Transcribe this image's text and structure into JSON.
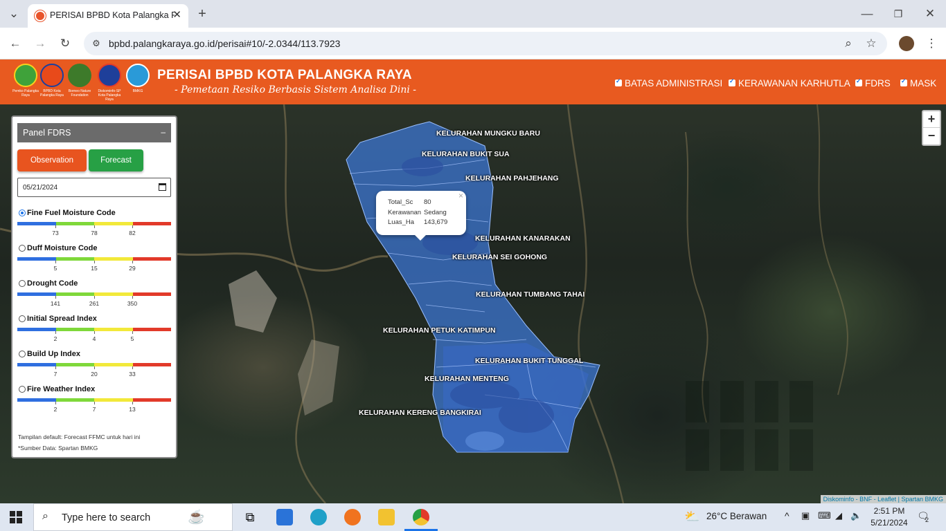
{
  "browser": {
    "tab_title": "PERISAI BPBD Kota Palangka Ra",
    "url": "bpbd.palangkaraya.go.id/perisai#10/-2.0344/113.7923"
  },
  "header": {
    "logos": [
      {
        "caption": "Pemko Palangka Raya"
      },
      {
        "caption": "BPBD Kota Palangka Raya"
      },
      {
        "caption": "Borneo Nature Foundation"
      },
      {
        "caption": "Diskominfo-SP Kota Palangka Raya"
      },
      {
        "caption": "BMKG"
      }
    ],
    "title": "PERISAI BPBD KOTA PALANGKA RAYA",
    "subtitle": "- Pemetaan Resiko Berbasis Sistem Analisa Dini -",
    "layers": [
      {
        "label": "BATAS ADMINISTRASI",
        "checked": true
      },
      {
        "label": "KERAWANAN KARHUTLA",
        "checked": true
      },
      {
        "label": "FDRS",
        "checked": true
      },
      {
        "label": "MASK",
        "checked": true
      }
    ]
  },
  "panel": {
    "title": "Panel FDRS",
    "minimize": "–",
    "observation_label": "Observation",
    "forecast_label": "Forecast",
    "date": "05/21/2024",
    "indices": [
      {
        "label": "Fine Fuel Moisture Code",
        "selected": true,
        "ticks": [
          "73",
          "78",
          "82"
        ]
      },
      {
        "label": "Duff Moisture Code",
        "selected": false,
        "ticks": [
          "5",
          "15",
          "29"
        ]
      },
      {
        "label": "Drought Code",
        "selected": false,
        "ticks": [
          "141",
          "261",
          "350"
        ]
      },
      {
        "label": "Initial Spread Index",
        "selected": false,
        "ticks": [
          "2",
          "4",
          "5"
        ]
      },
      {
        "label": "Build Up Index",
        "selected": false,
        "ticks": [
          "7",
          "20",
          "33"
        ]
      },
      {
        "label": "Fire Weather Index",
        "selected": false,
        "ticks": [
          "2",
          "7",
          "13"
        ]
      }
    ],
    "scale_colors": [
      "#2f6fe0",
      "#7fd83a",
      "#f2e93a",
      "#e23a2a"
    ],
    "note_default": "Tampilan default: Forecast FFMC untuk hari ini",
    "note_source": "*Sumber Data: Spartan BMKG"
  },
  "map": {
    "labels": [
      "KELURAHAN MUNGKU BARU",
      "KELURAHAN BUKIT SUA",
      "KELURAHAN PAHJEHANG",
      "KELURAHAN KANARAKAN",
      "KELURAHAN SEI GOHONG",
      "KELURAHAN TUMBANG TAHAI",
      "KELURAHAN PETUK KATIMPUN",
      "KELURAHAN BUKIT TUNGGAL",
      "KELURAHAN MENTENG",
      "KELURAHAN KERENG BANGKIRAI"
    ],
    "popup": {
      "rows": [
        {
          "key": "Total_Sc",
          "value": "80"
        },
        {
          "key": "Kerawanan",
          "value": "Sedang"
        },
        {
          "key": "Luas_Ha",
          "value": "143,679"
        }
      ],
      "close": "×"
    },
    "zoom_in": "+",
    "zoom_out": "−",
    "attribution": "Diskominfo - BNF - Leaflet | Spartan BMKG"
  },
  "taskbar": {
    "search_placeholder": "Type here to search",
    "weather": "26°C  Berawan",
    "time": "2:51 PM",
    "date": "5/21/2024",
    "notifications": "2"
  }
}
